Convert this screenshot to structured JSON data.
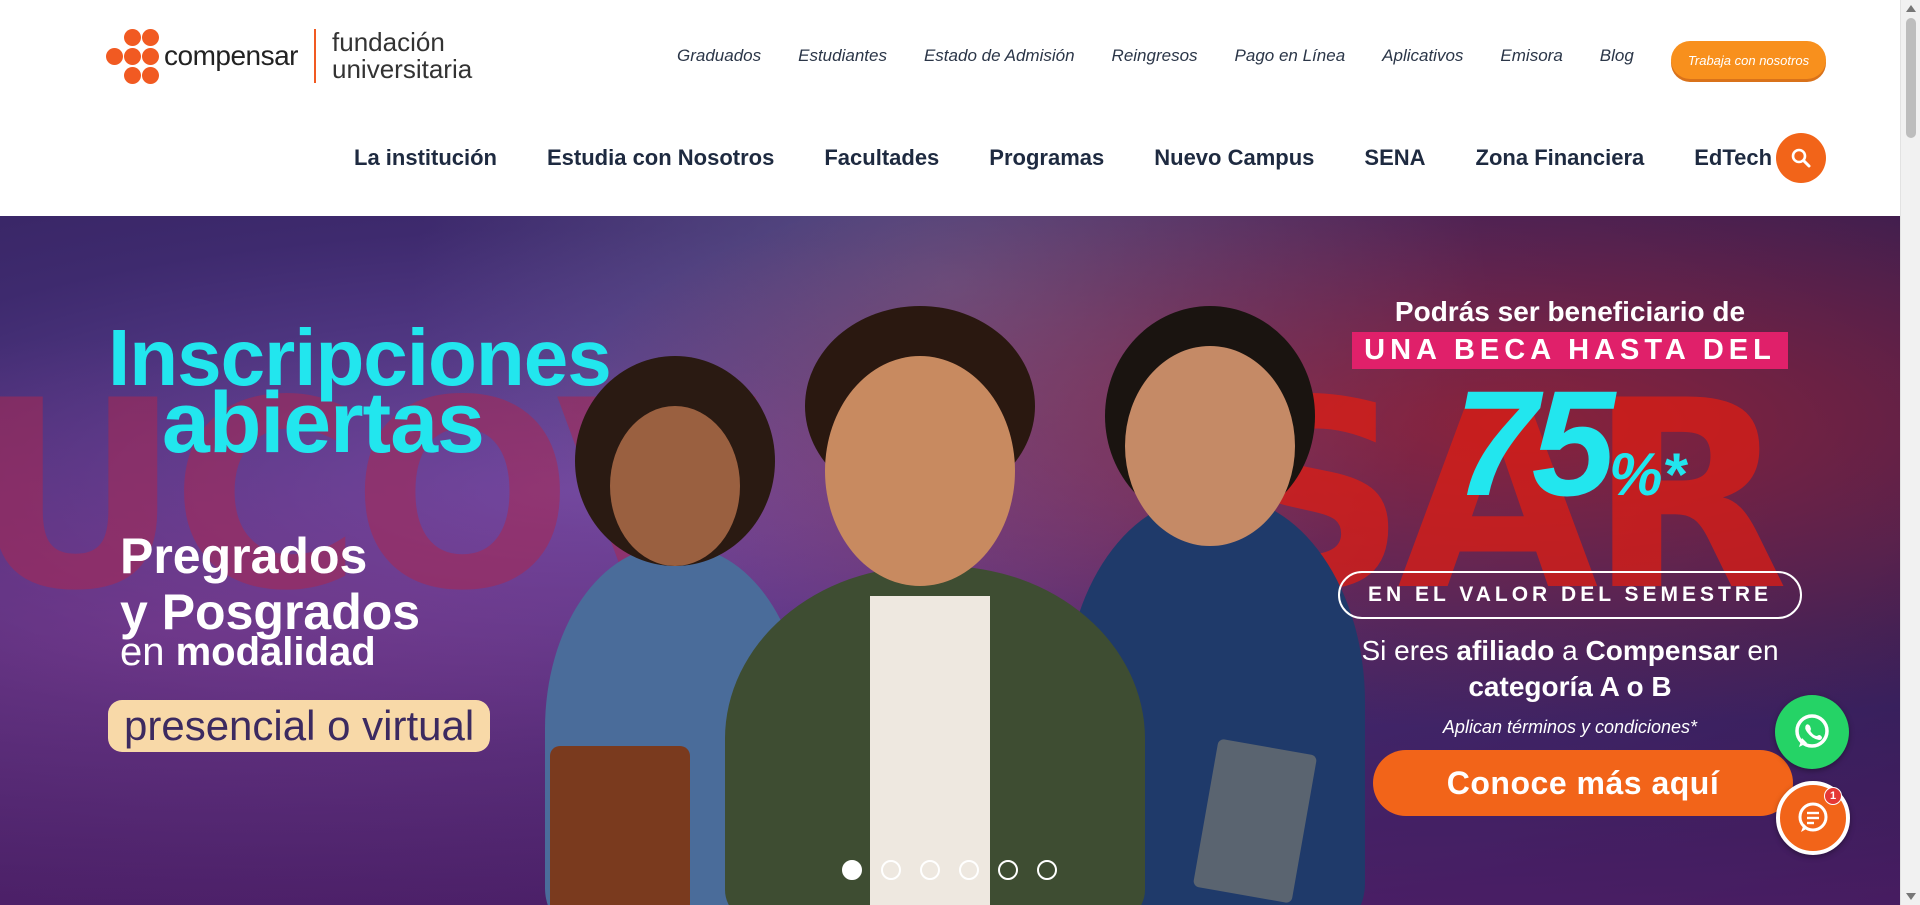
{
  "brand": {
    "name": "compensar",
    "sub_line1": "fundación",
    "sub_line2": "universitaria",
    "accent_color": "#f15a22"
  },
  "top_nav": {
    "items": [
      {
        "label": "Graduados"
      },
      {
        "label": "Estudiantes"
      },
      {
        "label": "Estado de Admisión"
      },
      {
        "label": "Reingresos"
      },
      {
        "label": "Pago en Línea"
      },
      {
        "label": "Aplicativos"
      },
      {
        "label": "Emisora"
      },
      {
        "label": "Blog"
      }
    ],
    "work_button": "Trabaja con nosotros"
  },
  "main_nav": {
    "items": [
      {
        "label": "La institución"
      },
      {
        "label": "Estudia con Nosotros"
      },
      {
        "label": "Facultades"
      },
      {
        "label": "Programas"
      },
      {
        "label": "Nuevo Campus"
      },
      {
        "label": "SENA"
      },
      {
        "label": "Zona Financiera"
      },
      {
        "label": "EdTech"
      }
    ],
    "search_icon": "search-icon"
  },
  "hero": {
    "title_line1": "Inscripciones",
    "title_line2": "abiertas",
    "sub_line1": "Pregrados",
    "sub_line2": "y Posgrados",
    "sub_line3_pre": "en ",
    "sub_line3_bold": "modalidad",
    "pill": "presencial o virtual",
    "promo": {
      "line1": "Podrás ser beneficiario de",
      "line2": "UNA BECA HASTA DEL",
      "number": "75",
      "percent": "%*",
      "box": "EN EL VALOR DEL SEMESTRE",
      "text_pre": "Si eres ",
      "text_b1": "afiliado",
      "text_mid": " a ",
      "text_b2": "Compensar",
      "text_post": " en",
      "text_b3": "categoría A o B",
      "terms": "Aplican términos y condiciones*"
    },
    "cta": "Conoce más aquí",
    "slides": 6,
    "active_slide": 1
  },
  "floating": {
    "whatsapp_icon": "whatsapp-icon",
    "chat_icon": "chat-icon",
    "chat_badge": "1"
  }
}
